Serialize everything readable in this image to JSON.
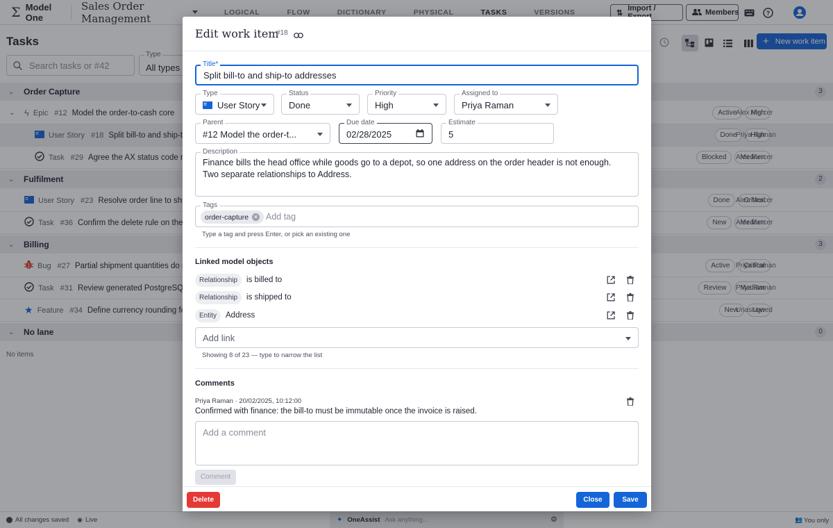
{
  "app": {
    "brand": "Model One",
    "model_name": "Sales Order Management"
  },
  "nav": {
    "tabs": [
      "LOGICAL",
      "FLOW",
      "DICTIONARY",
      "PHYSICAL",
      "TASKS",
      "VERSIONS"
    ],
    "active": "TASKS"
  },
  "toolbar": {
    "import_export": "Import / Export",
    "members": "Members"
  },
  "page": {
    "title": "Tasks",
    "search_placeholder": "Search tasks or #42",
    "type_label": "Type",
    "type_value": "All types",
    "new_button": "New work item"
  },
  "lanes": [
    {
      "name": "Order Capture",
      "count": "3",
      "items": [
        {
          "kind": "Epic",
          "num": "#12",
          "title": "Model the order-to-cash core",
          "status": "Active",
          "priority": "High",
          "assignee": "Alex Mercer",
          "icon": "bolt-icon"
        },
        {
          "kind": "User Story",
          "num": "#18",
          "title": "Split bill-to and ship-to addresses",
          "status": "Done",
          "priority": "High",
          "assignee": "Priya Raman",
          "icon": "book-icon"
        },
        {
          "kind": "Task",
          "num": "#29",
          "title": "Agree the AX status code mapping",
          "status": "Blocked",
          "priority": "Medium",
          "assignee": "Alex Mercer",
          "icon": "check-circle-icon"
        }
      ]
    },
    {
      "name": "Fulfilment",
      "count": "2",
      "items": [
        {
          "kind": "User Story",
          "num": "#23",
          "title": "Resolve order line to shipment",
          "status": "Done",
          "priority": "Critical",
          "assignee": "Alex Mercer",
          "icon": "book-icon"
        },
        {
          "kind": "Task",
          "num": "#36",
          "title": "Confirm the delete rule on the Sa",
          "status": "New",
          "priority": "Medium",
          "assignee": "Alex Mercer",
          "icon": "check-circle-icon"
        }
      ]
    },
    {
      "name": "Billing",
      "count": "3",
      "items": [
        {
          "kind": "Bug",
          "num": "#27",
          "title": "Partial shipment quantities do no",
          "status": "Active",
          "priority": "Critical",
          "assignee": "Priya Raman",
          "icon": "bug-icon"
        },
        {
          "kind": "Task",
          "num": "#31",
          "title": "Review generated PostgreSQL DI",
          "status": "Review",
          "priority": "Medium",
          "assignee": "Priya Raman",
          "icon": "check-circle-icon"
        },
        {
          "kind": "Feature",
          "num": "#34",
          "title": "Define currency rounding for",
          "status": "New",
          "priority": "Low",
          "assignee": "Unassigned",
          "icon": "star-icon"
        }
      ]
    },
    {
      "name": "No lane",
      "count": "0",
      "items": []
    }
  ],
  "no_items": "No items",
  "statusbar": {
    "saved": "All changes saved",
    "live": "Live",
    "assist_name": "OneAssist",
    "assist_placeholder": "Ask anything...",
    "visibility": "You only"
  },
  "modal": {
    "title": "Edit work item",
    "id": "#18",
    "title_label": "Title*",
    "title_value": "Split bill-to and ship-to addresses",
    "type_label": "Type",
    "type_value": "User Story",
    "status_label": "Status",
    "status_value": "Done",
    "priority_label": "Priority",
    "priority_value": "High",
    "assigned_label": "Assigned to",
    "assigned_value": "Priya Raman",
    "parent_label": "Parent",
    "parent_value": "#12 Model the order-t...",
    "due_label": "Due date",
    "due_value": "02/28/2025",
    "estimate_label": "Estimate",
    "estimate_value": "5",
    "description_label": "Description",
    "description_value": "Finance bills the head office while goods go to a depot, so one address on the order header is not enough. Two separate relationships to Address.",
    "tags_label": "Tags",
    "tag": "order-capture",
    "tags_placeholder": "Add tag",
    "tags_help": "Type a tag and press Enter, or pick an existing one",
    "linked_heading": "Linked model objects",
    "links": [
      {
        "kind": "Relationship",
        "name": "is billed to"
      },
      {
        "kind": "Relationship",
        "name": "is shipped to"
      },
      {
        "kind": "Entity",
        "name": "Address"
      }
    ],
    "add_link_placeholder": "Add link",
    "links_help": "Showing 8 of 23 — type to narrow the list",
    "comments_heading": "Comments",
    "comment_meta": "Priya Raman · 20/02/2025, 10:12:00",
    "comment_text": "Confirmed with finance: the bill-to must be immutable once the invoice is raised.",
    "comment_placeholder": "Add a comment",
    "comment_button": "Comment",
    "delete_button": "Delete",
    "close_button": "Close",
    "save_button": "Save"
  },
  "colors": {
    "accent": "#1565d8",
    "danger": "#e53935",
    "scrim": "#1e2128"
  }
}
